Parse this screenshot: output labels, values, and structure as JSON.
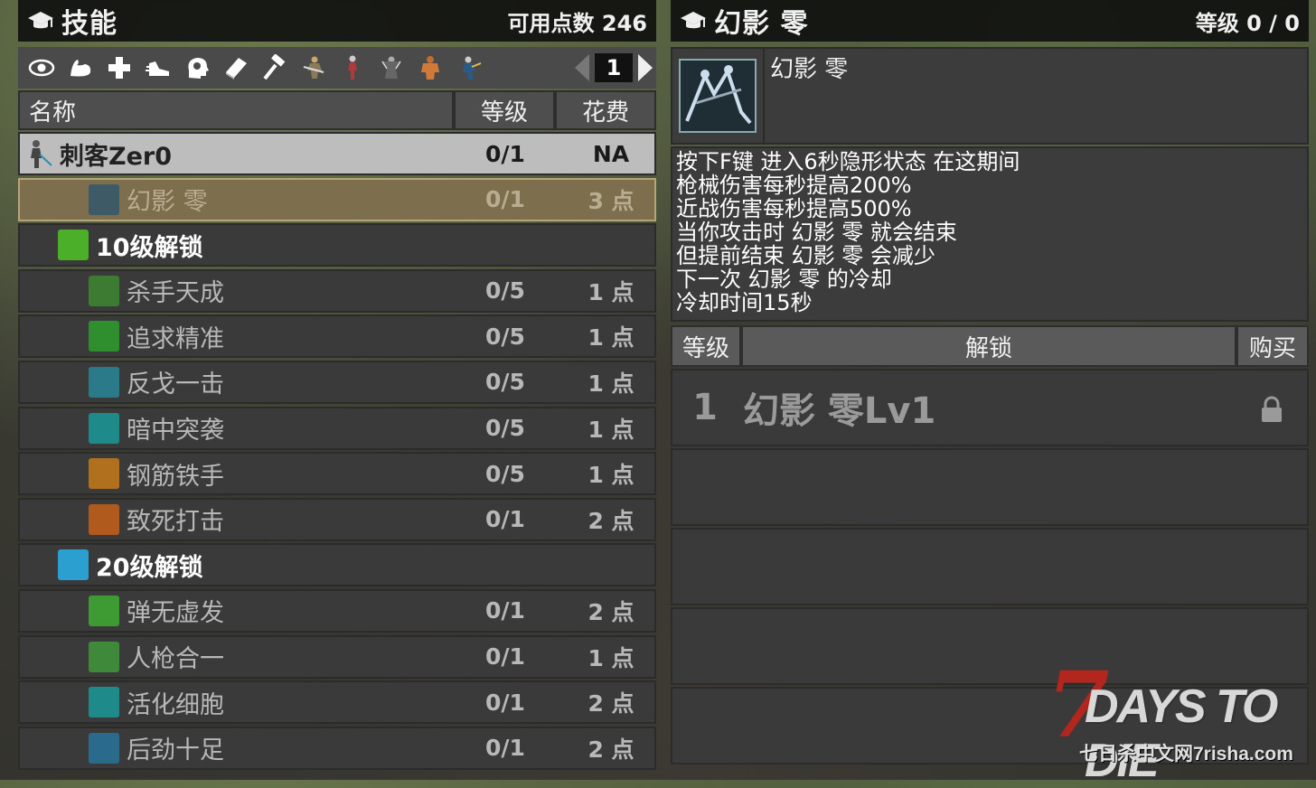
{
  "left_panel": {
    "title": "技能",
    "points_label": "可用点数 246",
    "page": "1",
    "toolbar_icons": [
      "perception-eye-icon",
      "strength-arm-icon",
      "fortitude-cross-icon",
      "agility-shoe-icon",
      "intellect-head-icon",
      "book-icon",
      "crafting-hammer-icon",
      "class-figure-1-icon",
      "class-figure-2-icon",
      "class-figure-3-icon",
      "class-figure-4-icon",
      "class-figure-5-icon"
    ],
    "headers": {
      "name": "名称",
      "level": "等级",
      "cost": "花费"
    }
  },
  "skills": [
    {
      "type": "class",
      "name": "刺客Zer0",
      "level": "0/1",
      "cost": "NA",
      "icon": "assassin-figure-icon",
      "color": "#888888"
    },
    {
      "type": "selected",
      "name": "幻影 零",
      "level": "0/1",
      "cost": "3 点",
      "icon": "phantom-icon",
      "color": "#3e5a66"
    },
    {
      "type": "unlock",
      "name": "10级解锁",
      "level": "",
      "cost": "",
      "icon": "green-badge-icon",
      "color": "#4caf2a"
    },
    {
      "type": "locked",
      "name": "杀手天成",
      "level": "0/5",
      "cost": "1 点",
      "icon": "hand-icon",
      "color": "#3d7a32"
    },
    {
      "type": "locked",
      "name": "追求精准",
      "level": "0/5",
      "cost": "1 点",
      "icon": "target-icon",
      "color": "#2f8f2f"
    },
    {
      "type": "locked",
      "name": "反戈一击",
      "level": "0/5",
      "cost": "1 点",
      "icon": "counter-icon",
      "color": "#2a7a8a"
    },
    {
      "type": "locked",
      "name": "暗中突袭",
      "level": "0/5",
      "cost": "1 点",
      "icon": "ambush-icon",
      "color": "#1f8a8a"
    },
    {
      "type": "locked",
      "name": "钢筋铁手",
      "level": "0/5",
      "cost": "1 点",
      "icon": "iron-hand-icon",
      "color": "#b0701e"
    },
    {
      "type": "locked",
      "name": "致死打击",
      "level": "0/1",
      "cost": "2 点",
      "icon": "lethal-icon",
      "color": "#b05a1e"
    },
    {
      "type": "unlock",
      "name": "20级解锁",
      "level": "",
      "cost": "",
      "icon": "blue-quill-icon",
      "color": "#2a9fd0"
    },
    {
      "type": "locked",
      "name": "弹无虚发",
      "level": "0/1",
      "cost": "2 点",
      "icon": "bullet-icon",
      "color": "#3e9a32"
    },
    {
      "type": "locked",
      "name": "人枪合一",
      "level": "0/1",
      "cost": "1 点",
      "icon": "gun-icon",
      "color": "#3e8a3a"
    },
    {
      "type": "locked",
      "name": "活化细胞",
      "level": "0/1",
      "cost": "2 点",
      "icon": "cell-icon",
      "color": "#1f8a8a"
    },
    {
      "type": "locked",
      "name": "后劲十足",
      "level": "0/1",
      "cost": "2 点",
      "icon": "burst-icon",
      "color": "#2a6a8a"
    }
  ],
  "right_panel": {
    "title": "幻影 零",
    "level_label": "等级 0 / 0",
    "skill_name": "幻影 零",
    "description": [
      "按下F键 进入6秒隐形状态 在这期间",
      "枪械伤害每秒提高200%",
      "近战伤害每秒提高500%",
      "当你攻击时 幻影 零 就会结束",
      "但提前结束 幻影 零 会减少",
      "下一次 幻影 零 的冷却",
      "冷却时间15秒"
    ],
    "unlock_headers": {
      "level": "等级",
      "unlock": "解锁",
      "buy": "购买"
    },
    "unlock_rows": [
      {
        "num": "1",
        "name": "幻影 零Lv1",
        "locked": true
      },
      {
        "num": "",
        "name": "",
        "locked": false
      },
      {
        "num": "",
        "name": "",
        "locked": false
      },
      {
        "num": "",
        "name": "",
        "locked": false
      },
      {
        "num": "",
        "name": "",
        "locked": false
      }
    ]
  },
  "watermark": {
    "logo_seven": "7",
    "logo_days": "DAYS TO DIE",
    "site": "七日杀中文网7risha.com"
  }
}
